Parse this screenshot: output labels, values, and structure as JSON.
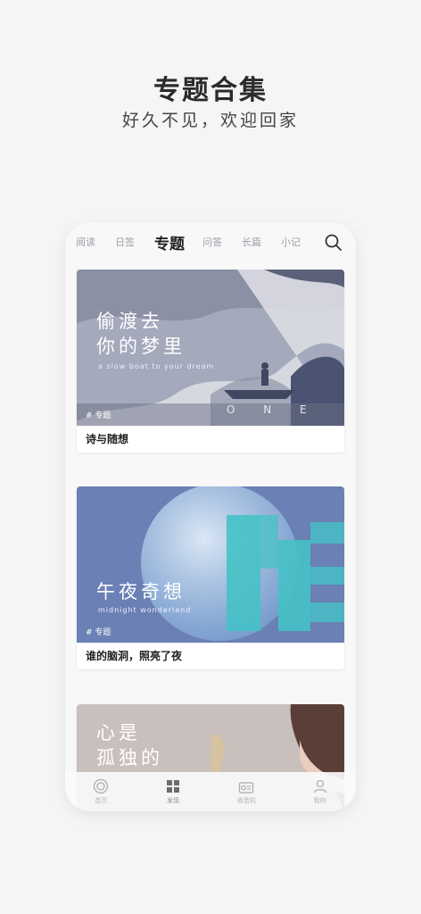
{
  "hero": {
    "title": "专题合集",
    "subtitle": "好久不见，欢迎回家"
  },
  "tabs": [
    {
      "label": "阅读",
      "active": false
    },
    {
      "label": "日签",
      "active": false
    },
    {
      "label": "专题",
      "active": true
    },
    {
      "label": "问答",
      "active": false
    },
    {
      "label": "长篇",
      "active": false
    },
    {
      "label": "小记",
      "active": false
    }
  ],
  "cards": [
    {
      "title_lines": [
        "偷渡去",
        "你的梦里"
      ],
      "subtitle": "a slow boat to your dream",
      "tag": "# 专题",
      "watermark": "O N E",
      "caption": "诗与随想"
    },
    {
      "title_lines": [
        "午夜奇想"
      ],
      "subtitle": "midnight wonderland",
      "tag": "# 专题",
      "caption": "谁的脑洞，照亮了夜"
    },
    {
      "title_lines": [
        "心是",
        "孤独的"
      ]
    }
  ],
  "bottom_nav": [
    {
      "label": "首页",
      "icon": "home-icon"
    },
    {
      "label": "发现",
      "icon": "grid-icon"
    },
    {
      "label": "收音机",
      "icon": "radio-icon"
    },
    {
      "label": "我的",
      "icon": "user-icon"
    }
  ],
  "colors": {
    "card1_bg": "#9ea3b6",
    "card2_bg": "#6a80b4",
    "card3_bg": "#c9bebb",
    "accent_teal": "#4fc9c9"
  }
}
